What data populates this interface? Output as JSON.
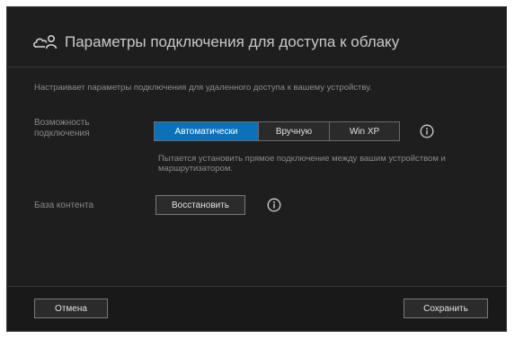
{
  "dialog": {
    "title": "Параметры подключения для доступа к облаку",
    "title_icon": "cloud-user-icon",
    "description": "Настраивает параметры подключения для удаленного доступа к вашему устройству."
  },
  "connection": {
    "label": "Возможность подключения",
    "options": [
      "Автоматически",
      "Вручную",
      "Win XP"
    ],
    "selected": "Автоматически",
    "info_icon": "info-icon",
    "hint": "Пытается установить прямое подключение между вашим устройством и маршрутизатором."
  },
  "content_base": {
    "label": "База контента",
    "button_label": "Восстановить",
    "info_icon": "info-icon"
  },
  "footer": {
    "cancel_label": "Отмена",
    "save_label": "Сохранить"
  },
  "colors": {
    "accent": "#0c71b8",
    "background": "#1e1e1e"
  }
}
